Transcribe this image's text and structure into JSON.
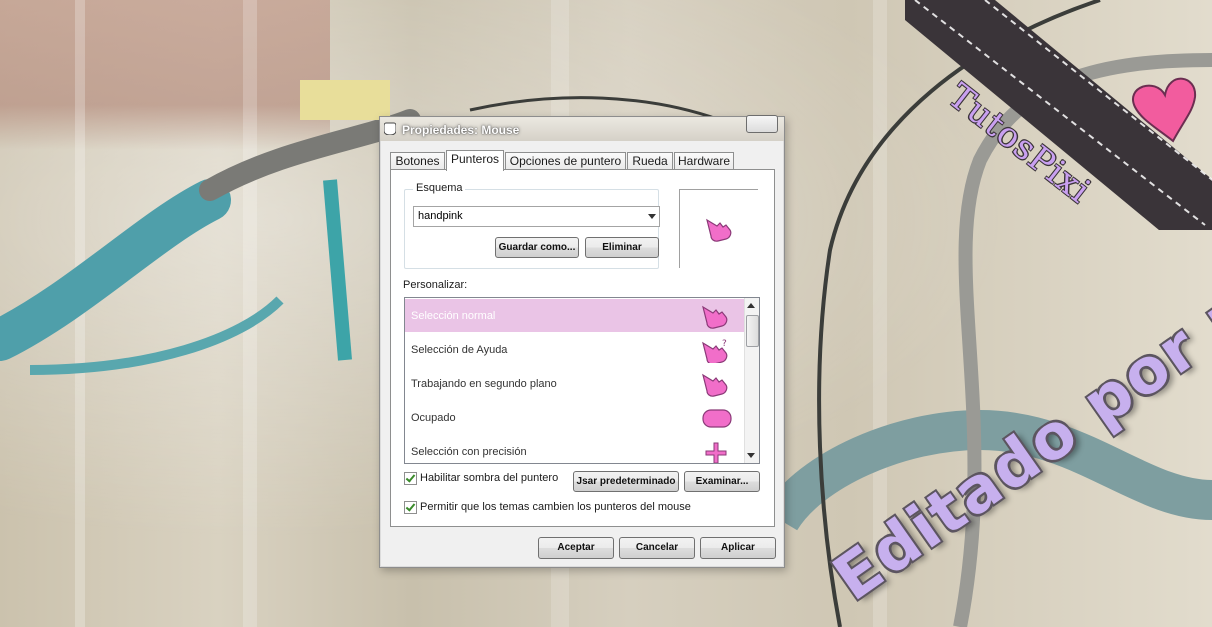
{
  "dialog": {
    "title": "Propiedades: Mouse",
    "tabs": [
      {
        "label": "Botones",
        "active": false
      },
      {
        "label": "Punteros",
        "active": true
      },
      {
        "label": "Opciones de puntero",
        "active": false
      },
      {
        "label": "Rueda",
        "active": false
      },
      {
        "label": "Hardware",
        "active": false
      }
    ],
    "scheme": {
      "legend": "Esquema",
      "selected": "handpink",
      "save_as_label": "Guardar como...",
      "delete_label": "Eliminar"
    },
    "customize_label": "Personalizar:",
    "pointer_list": [
      {
        "label": "Selección normal",
        "icon": "pink-hand-pointer-icon",
        "selected": true
      },
      {
        "label": "Selección de Ayuda",
        "icon": "pink-hand-help-icon",
        "selected": false
      },
      {
        "label": "Trabajando en segundo plano",
        "icon": "pink-hand-busy-icon",
        "selected": false
      },
      {
        "label": "Ocupado",
        "icon": "pink-blob-busy-icon",
        "selected": false
      },
      {
        "label": "Selección con precisión",
        "icon": "pink-crosshair-icon",
        "selected": false
      }
    ],
    "options": {
      "shadow_label": "Habilitar sombra del puntero",
      "shadow_checked": true,
      "use_default_label": "Jsar predeterminado",
      "browse_label": "Examinar...",
      "themes_label": "Permitir que los temas cambien los punteros del mouse",
      "themes_checked": true
    },
    "footer": {
      "ok_label": "Aceptar",
      "cancel_label": "Cancelar",
      "apply_label": "Aplicar"
    }
  },
  "overlay": {
    "ribbon_text": "TutosPixi",
    "signature": "Editado por mi!"
  },
  "colors": {
    "selection": "#eac4e6",
    "cursor_pink": "#f16ec9",
    "overlay_text": "#c7b0ee"
  }
}
